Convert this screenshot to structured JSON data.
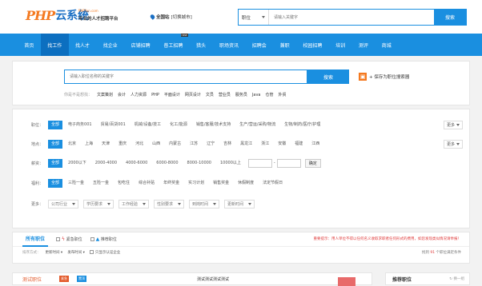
{
  "header": {
    "logo_php": "PHP",
    "logo_cn": "云系统",
    "logo_domain": "PHPYun.com",
    "slogan": "专业的人才招聘平台",
    "site_label": "全国站",
    "switch_city": "[切换城市]",
    "search": {
      "type": "职位",
      "placeholder": "请输入关键字",
      "button": "搜索"
    }
  },
  "nav": {
    "items": [
      "首页",
      "找工作",
      "找人才",
      "找企业",
      "店铺招聘",
      "普工招聘",
      "猎头",
      "职场资讯",
      "招聘会",
      "兼职",
      "校园招聘",
      "培训",
      "测评",
      "商城"
    ],
    "active_index": 1,
    "badge_index": 5,
    "badge": "new"
  },
  "job_search": {
    "placeholder": "请输入职位名称的关键字",
    "button": "搜索",
    "save_label": "+ 保存为职位搜索器",
    "hot_label": "你是不是想找：",
    "hot": [
      "文案策划",
      "会计",
      "人力资源",
      "PHP",
      "平面设计",
      "网页设计",
      "文员",
      "营业员",
      "服务员",
      "Java",
      "仓管",
      "外贸"
    ]
  },
  "filters": {
    "job": {
      "label": "职位：",
      "options": [
        "全部",
        "电子商务001",
        "贸易/百货001",
        "机械/设备/技工",
        "化工/能源",
        "销售/客服/技术支持",
        "生产/营运/采购/物流",
        "生物/制药/医疗/护理"
      ],
      "more": "更多"
    },
    "area": {
      "label": "地点：",
      "options": [
        "全部",
        "北京",
        "上海",
        "天津",
        "重庆",
        "河北",
        "山西",
        "内蒙古",
        "江苏",
        "辽宁",
        "吉林",
        "黑龙江",
        "浙江",
        "安徽",
        "福建",
        "江西"
      ],
      "more": "更多"
    },
    "salary": {
      "label": "薪资：",
      "options": [
        "全部",
        "2000以下",
        "2000-4000",
        "4000-6000",
        "6000-8000",
        "8000-10000",
        "10000以上"
      ],
      "dash": "-",
      "confirm": "确定"
    },
    "welfare": {
      "label": "福利：",
      "options": [
        "全部",
        "三险一金",
        "五险一金",
        "包吃住",
        "综合补贴",
        "年终奖金",
        "实习计划",
        "销售奖金",
        "休假制度",
        "法定节假日"
      ]
    },
    "more": {
      "label": "更多：",
      "dropdowns": [
        "公司行业",
        "学历要求",
        "工作经验",
        "性别要求",
        "到岗时间",
        "更新时间"
      ]
    }
  },
  "list": {
    "tab_all": "所有职位",
    "urgent": "紧急职位",
    "recommend": "推荐职位",
    "notice": "重要提示：用人单位不得以任何名义收取求职者任何形式的费用，如您发现类似情况请举报！",
    "sort_label": "排序方式：",
    "sort_update": "更新时间",
    "sort_publish": "发布时间",
    "auth_only": "只显示认证企业",
    "count_prefix": "找到",
    "count": "91",
    "count_suffix": "个职位满足条件"
  },
  "first_job": {
    "title": "测试职位",
    "tag_urgent": "紧急",
    "tag_top": "置顶",
    "company": "测试测试测试测试"
  },
  "sidebar": {
    "title": "推荐职位",
    "refresh": "换一组"
  }
}
